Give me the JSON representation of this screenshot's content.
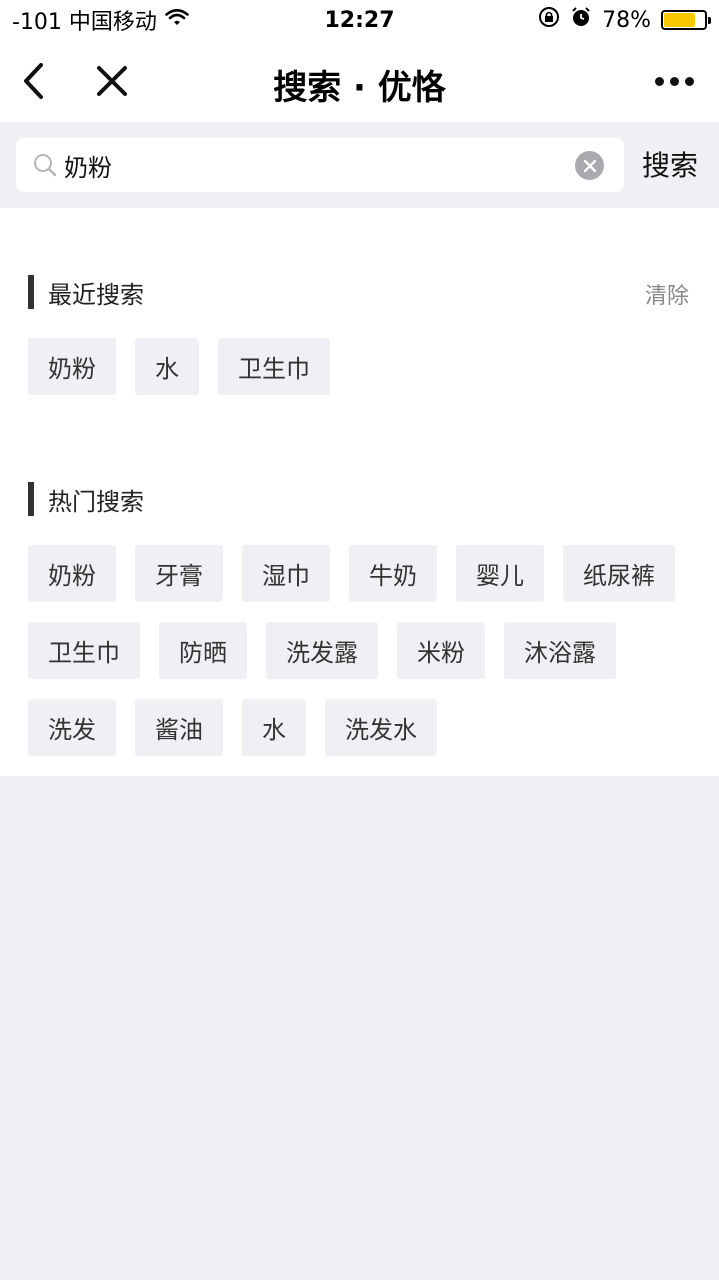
{
  "status_bar": {
    "carrier": "-101 中国移动",
    "time": "12:27",
    "battery": "78%",
    "battery_level": 0.78
  },
  "navbar": {
    "title": "搜索 · 优恪"
  },
  "search": {
    "value": "奶粉",
    "button_label": "搜索"
  },
  "recent": {
    "title": "最近搜索",
    "clear_label": "清除",
    "tags": [
      "奶粉",
      "水",
      "卫生巾"
    ]
  },
  "hot": {
    "title": "热门搜索",
    "tags": [
      "奶粉",
      "牙膏",
      "湿巾",
      "牛奶",
      "婴儿",
      "纸尿裤",
      "卫生巾",
      "防晒",
      "洗发露",
      "米粉",
      "沐浴露",
      "洗发",
      "酱油",
      "水",
      "洗发水"
    ]
  },
  "colors": {
    "accent": "#f7c800",
    "tag_bg": "#efeff4",
    "page_bg": "#efeff4"
  }
}
